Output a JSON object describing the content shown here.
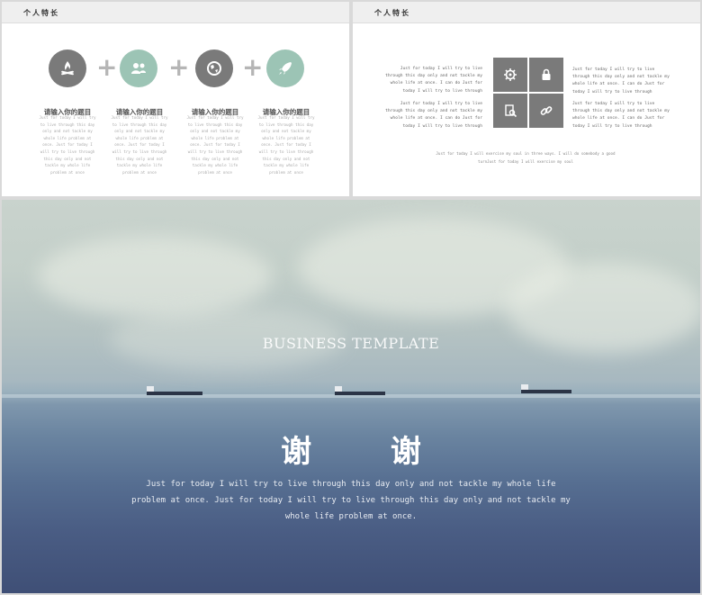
{
  "slide1": {
    "header": "个人特长",
    "columns": [
      {
        "icon": "campfire-icon",
        "title": "请输入你的题目",
        "body": "Just for today I will try to live through this day only and not tackle my whole life problem at once. Just for today I will try to live through this day only and not tackle my whole life problem at once"
      },
      {
        "icon": "users-icon",
        "title": "请输入你的题目",
        "body": "Just for today I will try to live through this day only and not tackle my whole life problem at once. Just for today I will try to live through this day only and not tackle my whole life problem at once"
      },
      {
        "icon": "globe-icon",
        "title": "请输入你的题目",
        "body": "Just for today I will try to live through this day only and not tackle my whole life problem at once. Just for today I will try to live through this day only and not tackle my whole life problem at once"
      },
      {
        "icon": "rocket-icon",
        "title": "请输入你的题目",
        "body": "Just for today I will try to live through this day only and not tackle my whole life problem at once. Just for today I will try to live through this day only and not tackle my whole life problem at once"
      }
    ],
    "colors": {
      "gray": "#7a7a7a",
      "green": "#9cc4b5",
      "plus": "#b5b5b5"
    }
  },
  "slide2": {
    "header": "个人特长",
    "left_top": "Just for today I will try to live through this day only and not tackle my whole life at once. I can do Just for today I will try to live through",
    "left_bottom": "Just for today I will try to live through this day only and not tackle my whole life at once. I can do Just for today I will try to live through",
    "right_top": "Just for today I will try to live through this day only and not tackle my whole life at once. I can do Just for today I will try to live through",
    "right_bottom": "Just for today I will try to live through this day only and not tackle my whole life at once. I can do Just for today I will try to live through",
    "bottom_note": "Just for today I will exercise my soul in three ways. I will do somebody a good turnJust for today I will exercise my soul",
    "puzzle_icons": [
      "gear-icon",
      "lock-icon",
      "document-search-icon",
      "link-icon"
    ]
  },
  "slide3": {
    "tagline": "BUSINESS TEMPLATE",
    "thanks": "谢 谢",
    "paragraph": "Just for today I will try to live through this day only and not tackle my whole life problem at once. Just for today I will try to live through this day only and not tackle my whole life problem at once."
  }
}
